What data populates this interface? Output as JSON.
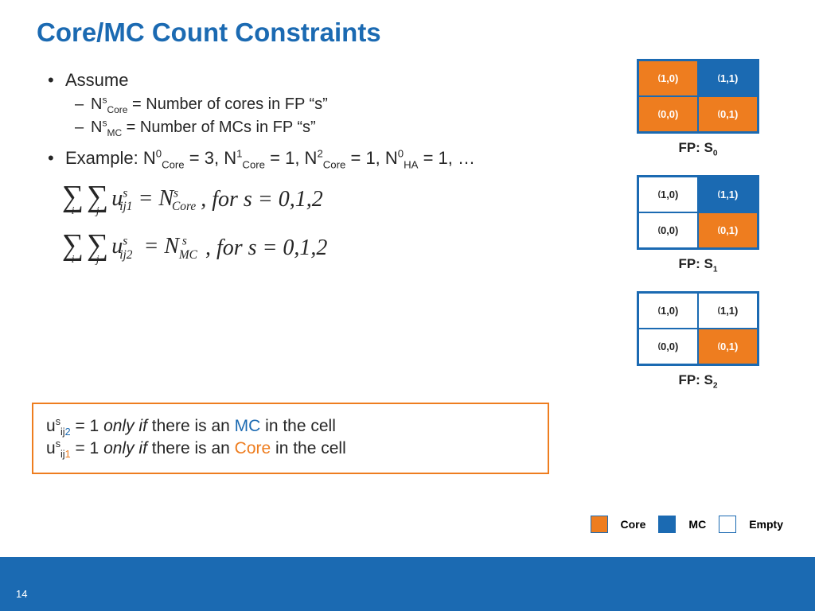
{
  "title": "Core/MC Count Constraints",
  "bullets": {
    "assume": "Assume",
    "def_core_pre": "N",
    "def_core_sup": "s",
    "def_core_sub": "Core",
    "def_core_post": " = Number of cores in FP “s”",
    "def_mc_pre": "N",
    "def_mc_sup": "s",
    "def_mc_sub": "MC",
    "def_mc_post": "   = Number of MCs in FP “s”",
    "example": "Example: N⁰_Core = 3, N¹_Core = 1, N²_Core = 1, N⁰_HA = 1, …"
  },
  "eq1": {
    "tail": ", for s = 0,1,2"
  },
  "eq2": {
    "tail": ",  for s = 0,1,2"
  },
  "note": {
    "line1_pre": "u",
    "line1_sup": "s",
    "line1_sub_ij": "ij",
    "line1_sub_k": "2",
    "line1_mid": " = 1 ",
    "line1_only": "only if",
    "line1_there": " there is an ",
    "line1_type": "MC",
    "line1_post": " in the cell",
    "line2_pre": "u",
    "line2_sup": "s",
    "line2_sub_ij": "ij",
    "line2_sub_k": "1",
    "line2_mid": " = 1 ",
    "line2_only": "only if",
    "line2_there": " there is an ",
    "line2_type": "Core",
    "line2_post": " in the cell"
  },
  "grids": [
    {
      "label_pre": "FP: S",
      "label_sub": "0",
      "cells": [
        {
          "coord": "1,0",
          "type": "core"
        },
        {
          "coord": "1,1",
          "type": "mc"
        },
        {
          "coord": "0,0",
          "type": "core"
        },
        {
          "coord": "0,1",
          "type": "core"
        }
      ]
    },
    {
      "label_pre": "FP: S",
      "label_sub": "1",
      "cells": [
        {
          "coord": "1,0",
          "type": "empty"
        },
        {
          "coord": "1,1",
          "type": "mc"
        },
        {
          "coord": "0,0",
          "type": "empty"
        },
        {
          "coord": "0,1",
          "type": "core"
        }
      ]
    },
    {
      "label_pre": "FP: S",
      "label_sub": "2",
      "cells": [
        {
          "coord": "1,0",
          "type": "empty"
        },
        {
          "coord": "1,1",
          "type": "empty"
        },
        {
          "coord": "0,0",
          "type": "empty"
        },
        {
          "coord": "0,1",
          "type": "core"
        }
      ]
    }
  ],
  "legend": {
    "core": "Core",
    "mc": "MC",
    "empty": "Empty"
  },
  "page": "14"
}
